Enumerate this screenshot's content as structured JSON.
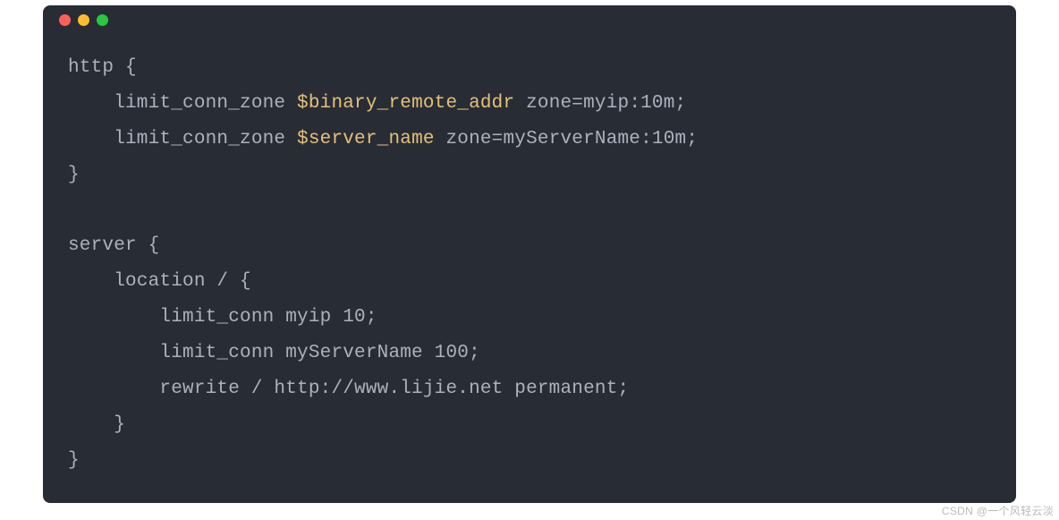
{
  "titlebar": {
    "dot1": "red",
    "dot2": "yellow",
    "dot3": "green"
  },
  "code": {
    "l1a": "http {",
    "l2a": "    limit_conn_zone ",
    "l2b": "$binary_remote_addr",
    "l2c": " zone=myip:10m;",
    "l3a": "    limit_conn_zone ",
    "l3b": "$server_name",
    "l3c": " zone=myServerName:10m;",
    "l4a": "}",
    "blank": "",
    "l5a": "server {",
    "l6a": "    location / {",
    "l7a": "        limit_conn myip 10;",
    "l8a": "        limit_conn myServerName 100;",
    "l9a": "        rewrite / http://www.lijie.net permanent;",
    "l10a": "    }",
    "l11a": "}"
  },
  "watermark": "CSDN @一个风轻云淡"
}
